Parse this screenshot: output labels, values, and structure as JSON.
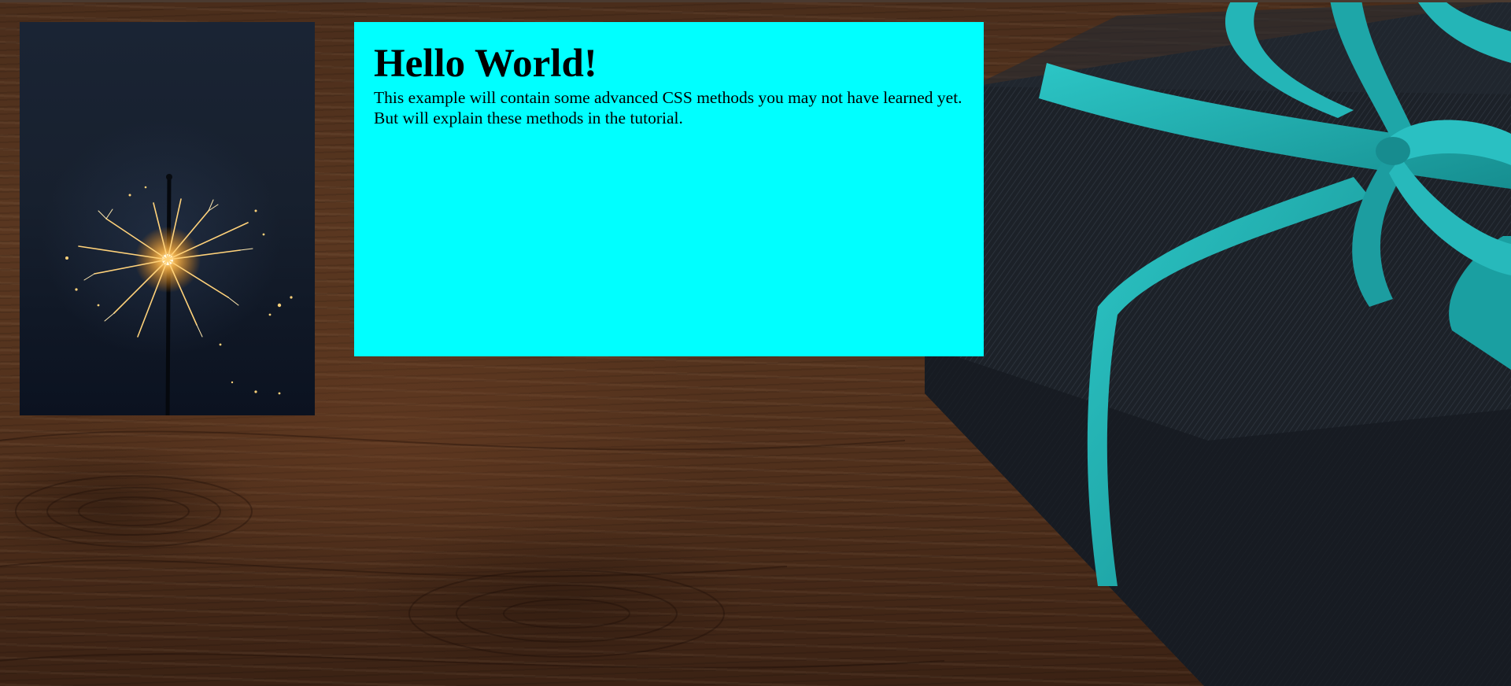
{
  "page": {
    "background_image": "wood-table-with-gift-box",
    "colors": {
      "content_box": "#00ffff",
      "ribbon": "#22b3b3",
      "wood": "#4f2f1b"
    }
  },
  "sidebar_image": {
    "icon": "sparkler-photo"
  },
  "content": {
    "heading": "Hello World!",
    "paragraph": "This example will contain some advanced CSS methods you may not have learned yet. But will explain these methods in the tutorial."
  }
}
